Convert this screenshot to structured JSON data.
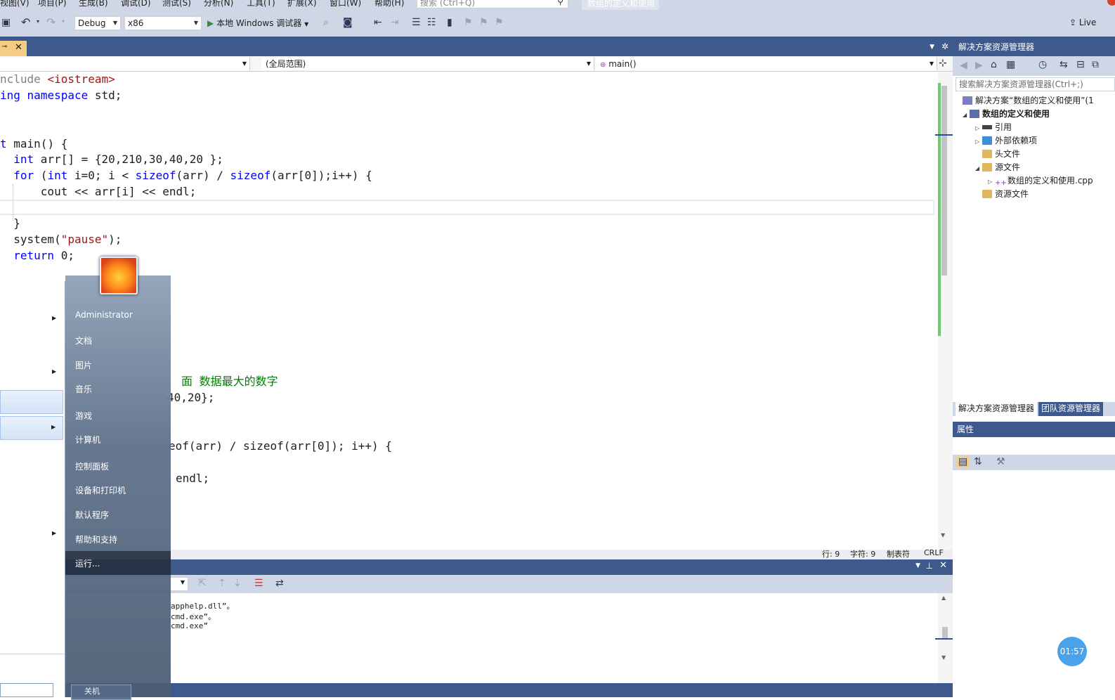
{
  "menu": [
    "视图(V)",
    "项目(P)",
    "生成(B)",
    "调试(D)",
    "测试(S)",
    "分析(N)",
    "工具(T)",
    "扩展(X)",
    "窗口(W)",
    "帮助(H)"
  ],
  "search_box": {
    "placeholder": "搜索 (Ctrl+Q)"
  },
  "solution_label": "数组的定义和使用",
  "toolbar": {
    "config": "Debug",
    "platform": "x86",
    "run_label": "本地 Windows 调试器",
    "live_label": "Live"
  },
  "nav": {
    "scope": "(全局范围)",
    "member": "main()"
  },
  "editor": {
    "lines": [
      {
        "html": "<span class='gr'>nclude</span> <span class='str'>&lt;iostream&gt;</span>"
      },
      {
        "html": "<span class='kw'>ing</span> <span class='kw'>namespace</span> std;"
      },
      {
        "html": ""
      },
      {
        "html": ""
      },
      {
        "html": "<span class='kw'>t</span> main() {"
      },
      {
        "html": "  <span class='kw'>int</span> arr[] = {20,210,30,40,20 };"
      },
      {
        "html": "  <span class='kw'>for</span> (<span class='kw'>int</span> i=0; i &lt; <span class='kw'>sizeof</span>(arr) / <span class='kw'>sizeof</span>(arr[0]);i++) {"
      },
      {
        "html": "      cout &lt;&lt; arr[i] &lt;&lt; endl;"
      },
      {
        "html": ""
      },
      {
        "html": "  }"
      },
      {
        "html": "  system(<span class='str'>\"pause\"</span>);"
      },
      {
        "html": "  <span class='kw'>return</span> 0;"
      }
    ],
    "lower_lines": [
      {
        "text": "面 数据最大的数字",
        "cls": "cmt"
      },
      {
        "text": "40,20};",
        "cls": ""
      },
      {
        "text": "eof(arr) / sizeof(arr[0]); i++) {",
        "cls": ""
      },
      {
        "text": "endl;",
        "cls": ""
      }
    ]
  },
  "status": {
    "line": "行: 9",
    "char": "字符: 9",
    "tabs": "制表符",
    "eol": "CRLF"
  },
  "output": {
    "lines": [
      "apphelp.dll”。",
      "cmd.exe”。",
      "cmd.exe”"
    ]
  },
  "solution_explorer": {
    "title": "解决方案资源管理器",
    "search": "搜索解决方案资源管理器(Ctrl+;)",
    "nodes": [
      {
        "label": "解决方案“数组的定义和使用”(1"
      },
      {
        "label": "数组的定义和使用"
      },
      {
        "label": "引用"
      },
      {
        "label": "外部依赖项"
      },
      {
        "label": "头文件"
      },
      {
        "label": "源文件"
      },
      {
        "label": "数组的定义和使用.cpp"
      },
      {
        "label": "资源文件"
      }
    ],
    "tabs": [
      "解决方案资源管理器",
      "团队资源管理器"
    ]
  },
  "properties": {
    "title": "属性"
  },
  "start_menu": {
    "user": "Administrator",
    "items": [
      "文档",
      "图片",
      "音乐",
      "游戏",
      "计算机",
      "控制面板",
      "设备和打印机",
      "默认程序",
      "帮助和支持",
      "运行..."
    ],
    "shutdown": "关机"
  },
  "clock": "01:57",
  "colors": {
    "accent": "#3e5a8c",
    "toolbar": "#cfd6e5",
    "keyword": "#0000ff",
    "string": "#a31515",
    "comment": "#008000"
  }
}
